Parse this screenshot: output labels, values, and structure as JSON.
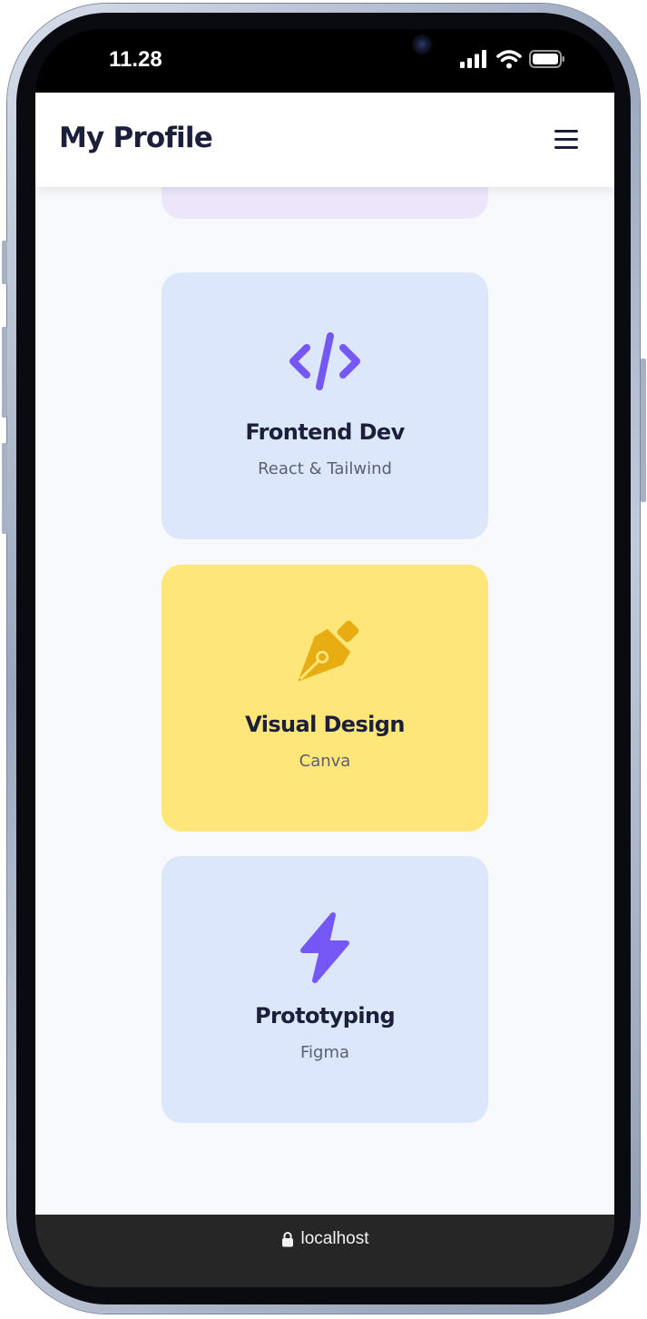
{
  "status_bar": {
    "time": "11.28",
    "icons": [
      "cellular-signal-icon",
      "wifi-icon",
      "battery-icon"
    ]
  },
  "header": {
    "title": "My Profile",
    "menu_icon": "hamburger-menu-icon"
  },
  "cards": [
    {
      "title": "Frontend Dev",
      "subtitle": "React & Tailwind",
      "icon": "code-icon",
      "background": "#dde7fb",
      "icon_color": "#7557f5"
    },
    {
      "title": "Visual Design",
      "subtitle": "Canva",
      "icon": "pen-nib-icon",
      "background": "#fee679",
      "icon_color": "#e8ad12"
    },
    {
      "title": "Prototyping",
      "subtitle": "Figma",
      "icon": "lightning-bolt-icon",
      "background": "#dde7fb",
      "icon_color": "#7557f5"
    }
  ],
  "peek_card_background": "#ede6fb",
  "browser": {
    "url": "localhost",
    "lock_icon": "lock-icon"
  },
  "colors": {
    "heading": "#1b1f3b",
    "subtext": "#5a5f73",
    "page_background": "#f8f9fc",
    "browser_bar": "#262626"
  }
}
